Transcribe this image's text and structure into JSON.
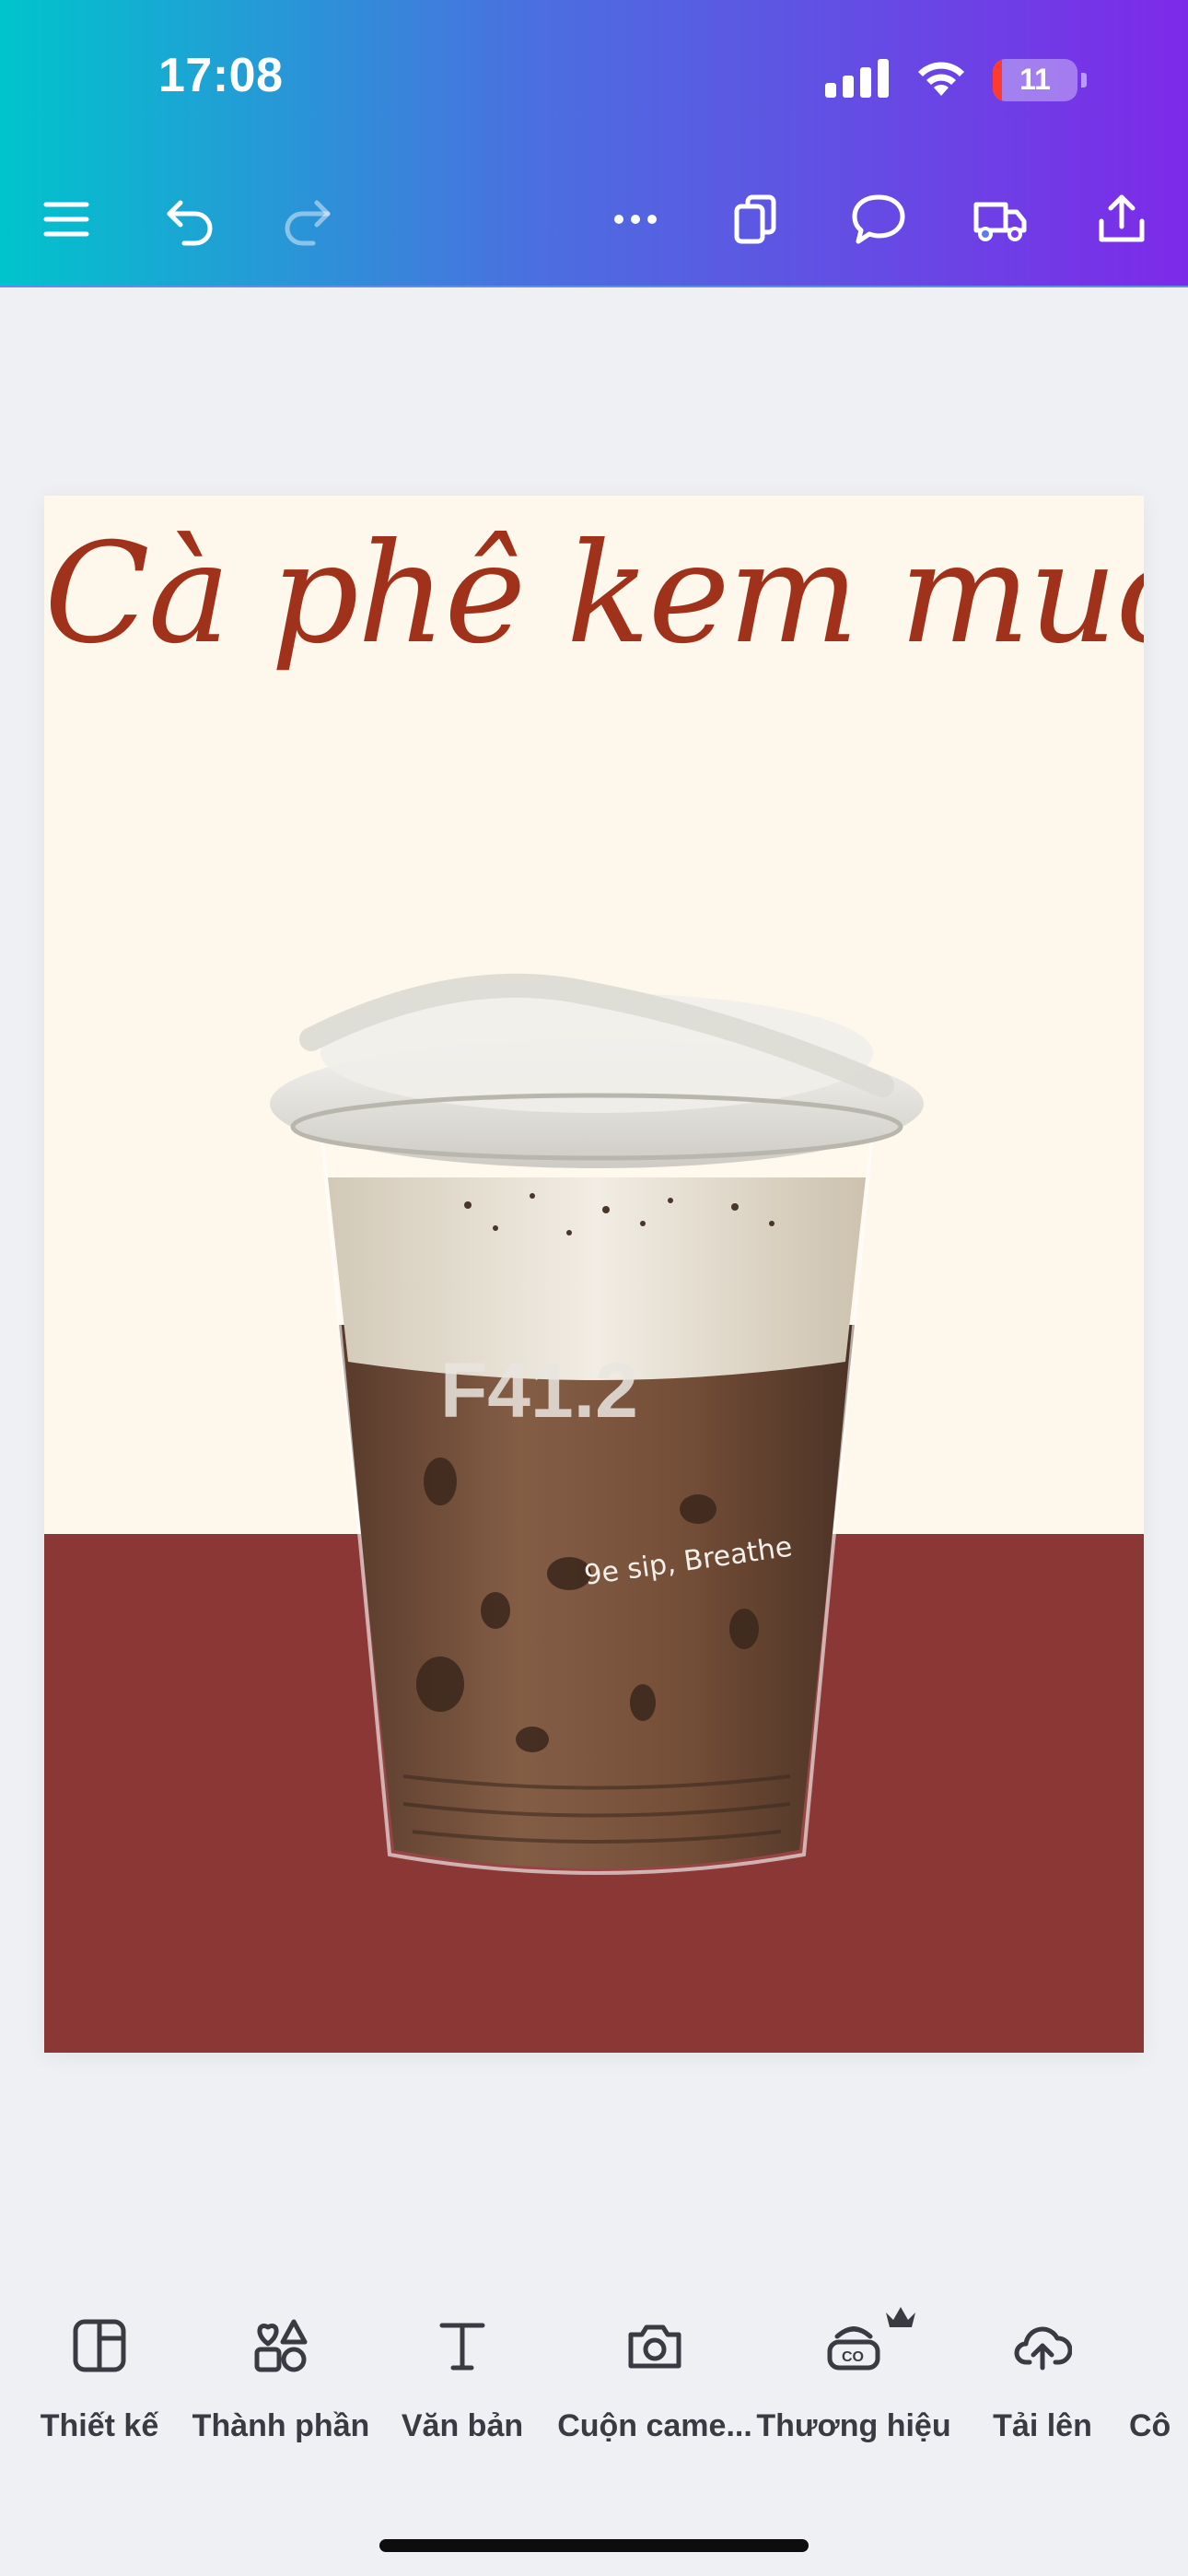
{
  "status_bar": {
    "time": "17:08",
    "battery": "11",
    "battery_level": 0.11
  },
  "toolbar": {
    "icons": [
      "menu-icon",
      "undo-icon",
      "redo-icon",
      "more-icon",
      "pages-icon",
      "comment-icon",
      "delivery-icon",
      "share-icon"
    ]
  },
  "design": {
    "title": "Cà phê kem muối",
    "cup_brand_text": "F41.2",
    "cup_tagline": "9e sip, Breathe"
  },
  "bottom_tabs": [
    {
      "label": "Thiết kế",
      "icon": "layout-icon"
    },
    {
      "label": "Thành phần",
      "icon": "elements-icon"
    },
    {
      "label": "Văn bản",
      "icon": "text-icon"
    },
    {
      "label": "Cuộn came...",
      "icon": "camera-icon"
    },
    {
      "label": "Thương hiệu",
      "icon": "brand-icon",
      "premium": true
    },
    {
      "label": "Tải lên",
      "icon": "upload-icon"
    },
    {
      "label": "Cô",
      "icon": "tools-icon"
    }
  ],
  "colors": {
    "header_gradient": [
      "#00c4cc",
      "#4b6fe0",
      "#7d2ae8"
    ],
    "title": "#a0311a",
    "canvas_bg": "#fef8ec",
    "band": "#8b3735"
  }
}
